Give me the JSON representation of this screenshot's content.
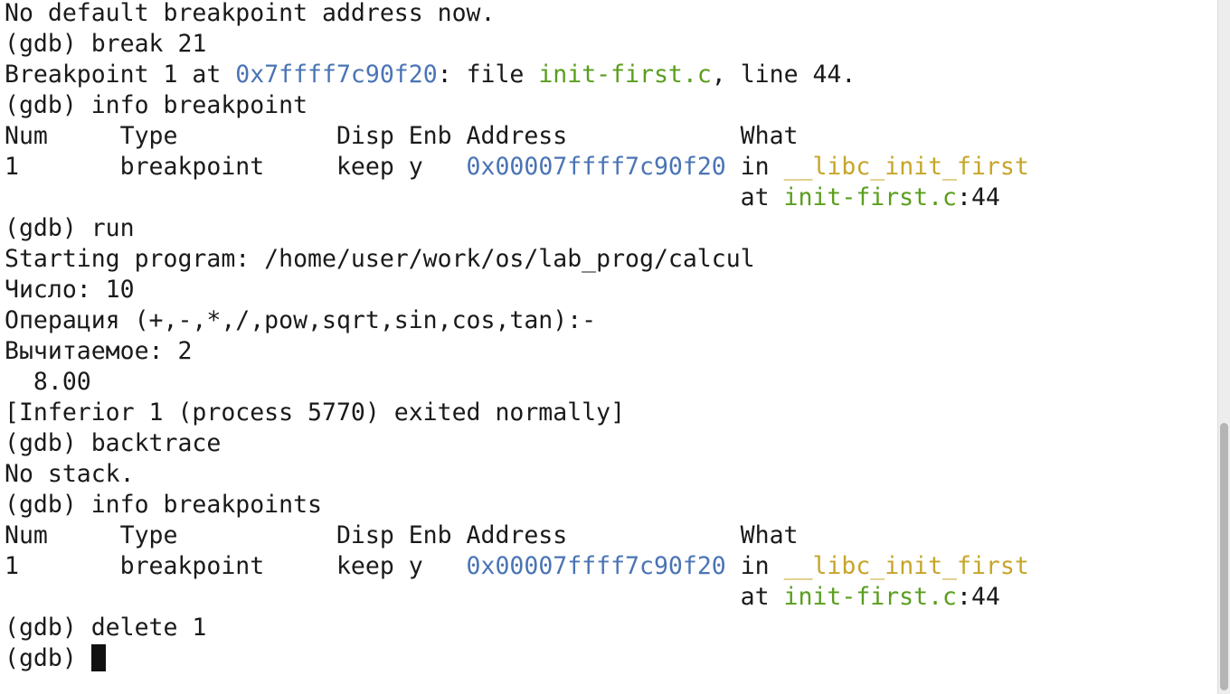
{
  "terminal": {
    "lines": [
      {
        "text": "No default breakpoint address now."
      },
      {
        "text": "(gdb) break 21"
      },
      {
        "bp_prefix": "Breakpoint 1 at ",
        "bp_addr": "0x7ffff7c90f20",
        "bp_mid": ": file ",
        "bp_file": "init-first.c",
        "bp_suffix": ", line 44."
      },
      {
        "text": "(gdb) info breakpoint"
      },
      {
        "text": "Num     Type           Disp Enb Address            What"
      },
      {
        "row_prefix": "1       breakpoint     keep y   ",
        "row_addr": "0x00007ffff7c90f20",
        "row_mid": " in ",
        "row_func": "__libc_init_first"
      },
      {
        "at_prefix": "                                                   at ",
        "at_file": "init-first.c",
        "at_suffix": ":44"
      },
      {
        "text": "(gdb) run"
      },
      {
        "text": "Starting program: /home/user/work/os/lab_prog/calcul"
      },
      {
        "text": "Число: 10"
      },
      {
        "text": "Операция (+,-,*,/,pow,sqrt,sin,cos,tan):-"
      },
      {
        "text": "Вычитаемое: 2"
      },
      {
        "text": "  8.00"
      },
      {
        "text": "[Inferior 1 (process 5770) exited normally]"
      },
      {
        "text": "(gdb) backtrace"
      },
      {
        "text": "No stack."
      },
      {
        "text": "(gdb) info breakpoints"
      },
      {
        "text": "Num     Type           Disp Enb Address            What"
      },
      {
        "row_prefix": "1       breakpoint     keep y   ",
        "row_addr": "0x00007ffff7c90f20",
        "row_mid": " in ",
        "row_func": "__libc_init_first"
      },
      {
        "at_prefix": "                                                   at ",
        "at_file": "init-first.c",
        "at_suffix": ":44"
      },
      {
        "text": "(gdb) delete 1"
      },
      {
        "prompt": "(gdb) "
      }
    ]
  },
  "colors": {
    "background": "#ffffff",
    "text": "#1a1a1a",
    "address": "#4a74b5",
    "file": "#5a9e1e",
    "function": "#c7a52a"
  },
  "icons": {
    "cursor": "block-cursor-icon"
  }
}
